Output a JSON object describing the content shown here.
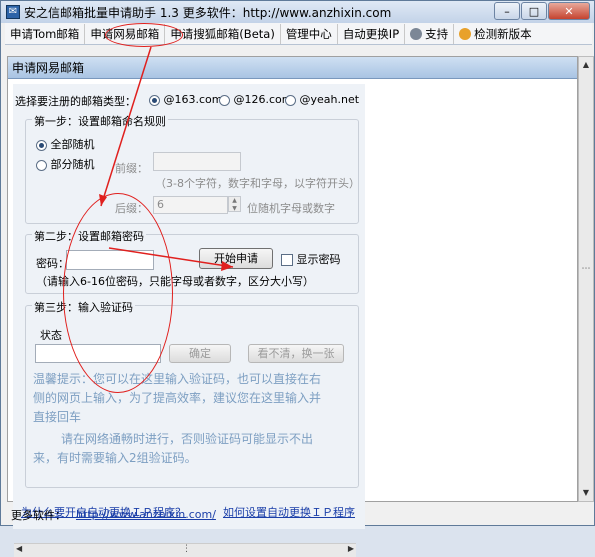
{
  "window": {
    "title": "安之信邮箱批量申请助手 1.3   更多软件：http://www.anzhixin.com",
    "min": "–",
    "max": "□",
    "close": "✕"
  },
  "menu": [
    {
      "label": "申请Tom邮箱",
      "icon": ""
    },
    {
      "label": "申请网易邮箱",
      "icon": ""
    },
    {
      "label": "申请搜狐邮箱(Beta)",
      "icon": ""
    },
    {
      "label": "管理中心",
      "icon": ""
    },
    {
      "label": "自动更换IP",
      "icon": ""
    },
    {
      "label": "支持",
      "icon": "gear-icon"
    },
    {
      "label": "检测新版本",
      "icon": "update-icon"
    }
  ],
  "panel": {
    "header": "申请网易邮箱",
    "type_label": "选择要注册的邮箱类型：",
    "types": [
      "@163.com",
      "@126.com",
      "@yeah.net"
    ],
    "step1": {
      "title": "第一步：设置邮箱命名规则",
      "full_random": "全部随机",
      "partial_random": "部分随机",
      "prefix_label": "前缀：",
      "prefix_hint": "（3-8个字符，数字和字母，以字符开头）",
      "suffix_label": "后缀：",
      "suffix_value": "6",
      "suffix_hint": "位随机字母或数字"
    },
    "step2": {
      "title": "第二步：设置邮箱密码",
      "password_label": "密码：",
      "start_button": "开始申请",
      "show_password": "显示密码",
      "hint": "（请输入6-16位密码，只能字母或者数字，区分大小写）"
    },
    "step3": {
      "title": "第三步：输入验证码",
      "status_label": "状态",
      "confirm_button": "确定",
      "refresh_button": "看不清，换一张",
      "tip_line1": "温馨提示：您可以在这里输入验证码，也可以直接在右",
      "tip_line2": "侧的网页上输入，为了提高效率，建议您在这里输入并",
      "tip_line3": "直接回车",
      "tip_line4": "请在网络通畅时进行，否则验证码可能显示不出",
      "tip_line5": "来，有时需要输入2组验证码。"
    },
    "bottom_links": [
      "为什么要开启自动更换ＩＰ程序？",
      "如何设置自动更换ＩＰ程序"
    ]
  },
  "statusbar": {
    "label": "更多软件：",
    "url": "http://www.anzhixin.com/"
  }
}
